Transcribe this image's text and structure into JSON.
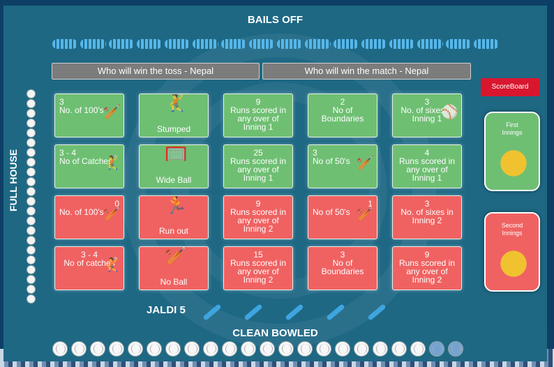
{
  "titles": {
    "top": "BAILS OFF",
    "side": "FULL HOUSE",
    "bottom": "CLEAN BOWLED",
    "jaldi": "JALDI 5"
  },
  "predictions": {
    "toss": "Who will win the toss - Nepal",
    "match": "Who will win the match - Nepal"
  },
  "scoreboard_label": "ScoreBoard",
  "innings": {
    "first": "First\nInnings",
    "second": "Second\nInnings"
  },
  "tiles": [
    {
      "num": "3",
      "text": "No. of 100's",
      "color": "green",
      "icon": "batsman-icon"
    },
    {
      "num": "",
      "text": "Stumped",
      "color": "green",
      "icon": "fielder-catch-icon"
    },
    {
      "num": "9",
      "text": "Runs scored in any over of Inning 1",
      "color": "green",
      "icon": ""
    },
    {
      "num": "2",
      "text": "No of Boundaries",
      "color": "green",
      "icon": ""
    },
    {
      "num": "3",
      "text": "No. of sixes in Inning 1",
      "color": "green",
      "icon": "cricket-ball-icon"
    },
    {
      "num": "3 - 4",
      "text": "No of Catches",
      "color": "green",
      "icon": "fielder-catch-icon"
    },
    {
      "num": "",
      "text": "Wide Ball",
      "color": "green",
      "icon": "wicket-icon"
    },
    {
      "num": "25",
      "text": "Runs scored in any over of Inning 1",
      "color": "green",
      "icon": ""
    },
    {
      "num": "3",
      "text": "No of 50's",
      "color": "green",
      "icon": "diving-batsman-icon"
    },
    {
      "num": "4",
      "text": "Runs scored in any over of Inning 1",
      "color": "green",
      "icon": ""
    },
    {
      "num": "0",
      "text": "No. of 100's",
      "color": "red",
      "icon": "batsman-icon"
    },
    {
      "num": "",
      "text": "Run out",
      "color": "red",
      "icon": "runner-icon"
    },
    {
      "num": "9",
      "text": "Runs scored in any over of Inning 2",
      "color": "red",
      "icon": ""
    },
    {
      "num": "1",
      "text": "No of 50's",
      "color": "red",
      "icon": "diving-batsman-icon"
    },
    {
      "num": "3",
      "text": "No. of sixes in Inning 2",
      "color": "red",
      "icon": ""
    },
    {
      "num": "3 - 4",
      "text": "No of catches",
      "color": "red",
      "icon": "fielder-catch-icon"
    },
    {
      "num": "",
      "text": "No Ball",
      "color": "red",
      "icon": "bowler-icon"
    },
    {
      "num": "15",
      "text": "Runs scored in any over of Inning 2",
      "color": "red",
      "icon": ""
    },
    {
      "num": "3",
      "text": "No of Boundaries",
      "color": "red",
      "icon": ""
    },
    {
      "num": "9",
      "text": "Runs scored in any over of Inning 2",
      "color": "red",
      "icon": ""
    }
  ],
  "full_house_balls": 22,
  "clean_bowled": {
    "total": 22,
    "remaining_blue": 2
  },
  "jaldi_bats": 5,
  "colors": {
    "green": "#6fbf73",
    "red": "#f06262",
    "board": "#1e6884",
    "scoreboard": "#d8172f"
  }
}
